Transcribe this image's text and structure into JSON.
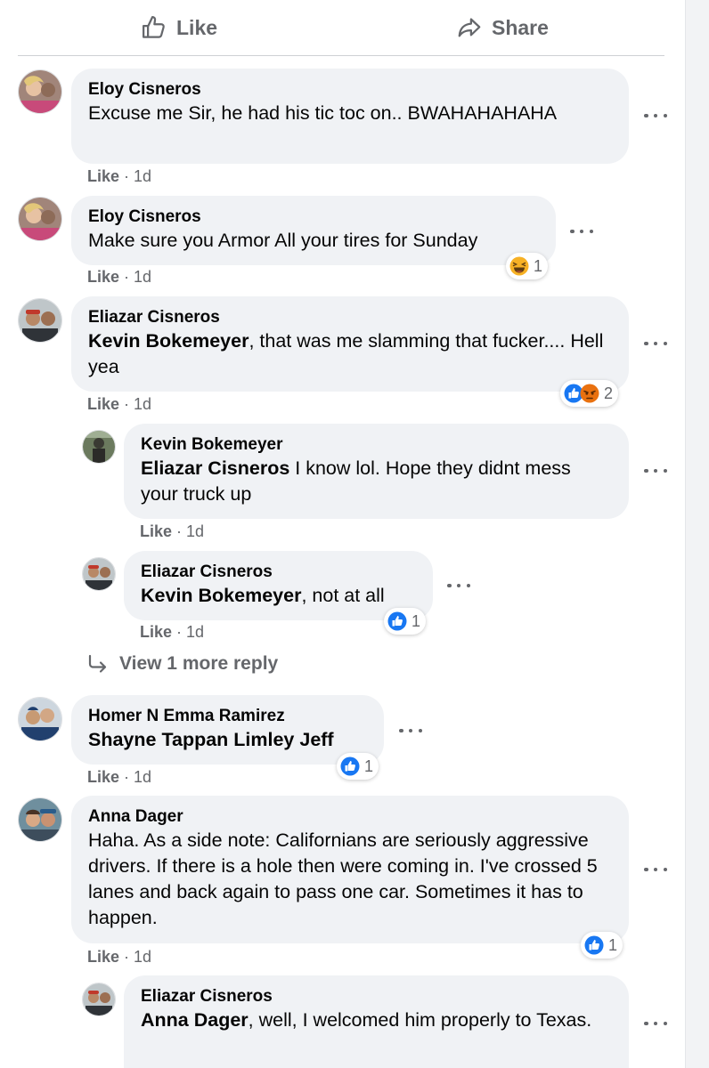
{
  "actions": {
    "like_label": "Like",
    "share_label": "Share"
  },
  "comments": [
    {
      "author": "Eloy Cisneros",
      "text": "Excuse me Sir, he had his tic toc on.. BWAHAHAHAHA",
      "like": "Like",
      "time": "1d"
    },
    {
      "author": "Eloy Cisneros",
      "text": "Make sure you Armor All your tires for Sunday",
      "like": "Like",
      "time": "1d",
      "reaction_count": "1",
      "reaction_icons": [
        "haha-icon"
      ]
    },
    {
      "author": "Eliazar Cisneros",
      "tag": "Kevin Bokemeyer",
      "text": ", that was me slamming that fucker.... Hell yea",
      "like": "Like",
      "time": "1d",
      "reaction_count": "2",
      "reaction_icons": [
        "like-reaction-icon",
        "angry-icon"
      ]
    },
    {
      "author": "Kevin Bokemeyer",
      "tag": "Eliazar Cisneros",
      "text": " I know lol. Hope they didnt mess your truck up",
      "like": "Like",
      "time": "1d"
    },
    {
      "author": "Eliazar Cisneros",
      "tag": "Kevin Bokemeyer",
      "text": ", not at all",
      "like": "Like",
      "time": "1d",
      "reaction_count": "1",
      "reaction_icons": [
        "like-reaction-icon"
      ]
    },
    {
      "author": "Homer N Emma Ramirez",
      "tag": "Shayne Tappan Limley Jeff",
      "text": "",
      "like": "Like",
      "time": "1d",
      "reaction_count": "1",
      "reaction_icons": [
        "like-reaction-icon"
      ]
    },
    {
      "author": "Anna Dager",
      "text": "Haha. As a side note: Californians are seriously aggressive drivers. If there is a hole then were coming in. I've crossed 5 lanes and back again to pass one car. Sometimes it has to happen.",
      "like": "Like",
      "time": "1d",
      "reaction_count": "1",
      "reaction_icons": [
        "like-reaction-icon"
      ]
    },
    {
      "author": "Eliazar Cisneros",
      "tag": "Anna Dager",
      "text": ", well, I welcomed him properly to Texas."
    }
  ],
  "view_more_replies": "View 1 more reply",
  "colors": {
    "bubble": "#f0f2f5",
    "muted": "#65676b",
    "like_blue": "#1877f2",
    "angry_orange": "#e9710f",
    "haha_yellow": "#f7b125"
  }
}
